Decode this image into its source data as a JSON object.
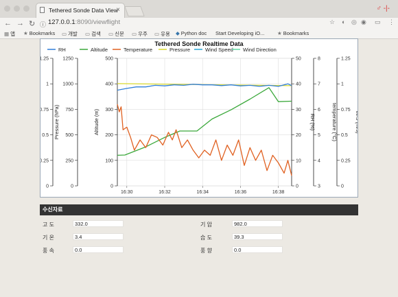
{
  "browser": {
    "tab_title": "Tethered Sonde Data View",
    "url_host": "127.0.0.1",
    "url_path": ":8090/viewflight",
    "ext_icon_text": "♂ -|-",
    "bookmarks": [
      {
        "icon": "apps-icon",
        "label": "앱"
      },
      {
        "icon": "star-icon",
        "label": "Bookmarks"
      },
      {
        "icon": "folder-icon",
        "label": "개발"
      },
      {
        "icon": "folder-icon",
        "label": "검색"
      },
      {
        "icon": "folder-icon",
        "label": "신문"
      },
      {
        "icon": "folder-icon",
        "label": "우주"
      },
      {
        "icon": "folder-icon",
        "label": "유용"
      },
      {
        "icon": "python-icon",
        "label": "Python doc"
      },
      {
        "icon": "apple-icon",
        "label": "Start Developing iO..."
      },
      {
        "icon": "star-icon",
        "label": "Bookmarks"
      }
    ]
  },
  "chart_data": {
    "type": "line",
    "title": "Tethered Sonde Realtime Data",
    "legend": [
      "RH",
      "Altitude",
      "Temperature",
      "Pressure",
      "Wind Speed",
      "Wind Direction"
    ],
    "legend_colors": [
      "#2f7ed8",
      "#3aa83a",
      "#e06020",
      "#d9d92a",
      "#29a7d6",
      "#5fd7a0"
    ],
    "legend_placement": "top",
    "x_ticks": [
      "16:30",
      "16:32",
      "16:34",
      "16:36",
      "16:38"
    ],
    "x_range_minutes": [
      29.5,
      38.7
    ],
    "grid": true,
    "axes": {
      "wd": {
        "label": "W/D (Degree)",
        "ticks": [
          "0",
          "0.25",
          "0.5",
          "0.75",
          "1",
          "1.25"
        ],
        "range": [
          0,
          1.25
        ]
      },
      "pressure": {
        "label": "Pressure (hPa)",
        "ticks": [
          "0",
          "250",
          "500",
          "750",
          "1000",
          "1250"
        ],
        "range": [
          0,
          1250
        ]
      },
      "altitude": {
        "label": "Altitude (m)",
        "ticks": [
          "0",
          "100",
          "200",
          "300",
          "400",
          "500"
        ],
        "range": [
          0,
          500
        ]
      },
      "rh": {
        "label": "RH (%)",
        "ticks": [
          "0",
          "10",
          "20",
          "30",
          "40",
          "50"
        ],
        "range": [
          0,
          50
        ]
      },
      "temperature": {
        "label": "temperature (°C)",
        "ticks": [
          "3",
          "4",
          "5",
          "6",
          "7",
          "8"
        ],
        "range": [
          3,
          8
        ]
      },
      "ws": {
        "label": "W/S (m/s)",
        "ticks": [
          "0",
          "0.25",
          "0.5",
          "0.75",
          "1",
          "1.25"
        ],
        "range": [
          0,
          1.25
        ]
      }
    },
    "series": [
      {
        "name": "Pressure",
        "axis": "pressure",
        "x": [
          29.5,
          38.7
        ],
        "values": [
          1002,
          982
        ]
      },
      {
        "name": "RH",
        "axis": "rh",
        "x": [
          29.5,
          30.0,
          30.5,
          31.0,
          31.5,
          32.0,
          32.5,
          33.0,
          33.5,
          34.0,
          34.5,
          35.0,
          35.5,
          36.0,
          36.5,
          37.0,
          37.5,
          38.0,
          38.5,
          38.7
        ],
        "values": [
          37.5,
          38.2,
          38.8,
          38.8,
          39.4,
          39.2,
          39.6,
          39.4,
          39.8,
          39.6,
          39.6,
          39.3,
          39.6,
          39.2,
          39.4,
          39.0,
          39.4,
          39.0,
          40.0,
          39.3
        ]
      },
      {
        "name": "Altitude",
        "axis": "altitude",
        "x": [
          29.5,
          29.9,
          31.0,
          32.0,
          32.8,
          33.7,
          34.5,
          35.5,
          36.5,
          37.5,
          38.0,
          38.7
        ],
        "values": [
          120,
          121,
          153,
          190,
          215,
          215,
          262,
          298,
          340,
          385,
          330,
          332
        ]
      },
      {
        "name": "Temperature",
        "axis": "temperature",
        "x": [
          29.5,
          29.6,
          29.7,
          29.8,
          30.0,
          30.2,
          30.4,
          30.7,
          31.0,
          31.3,
          31.6,
          31.9,
          32.2,
          32.4,
          32.6,
          32.9,
          33.2,
          33.5,
          33.8,
          34.1,
          34.4,
          34.7,
          35.0,
          35.3,
          35.6,
          35.9,
          36.2,
          36.5,
          36.8,
          37.1,
          37.4,
          37.7,
          38.0,
          38.3,
          38.5,
          38.7
        ],
        "values": [
          6.2,
          5.9,
          6.1,
          5.2,
          5.3,
          4.9,
          4.4,
          4.8,
          4.5,
          5.0,
          4.9,
          4.6,
          5.1,
          4.8,
          5.2,
          4.5,
          4.8,
          4.4,
          4.1,
          4.4,
          4.2,
          4.8,
          4.0,
          4.6,
          4.2,
          4.8,
          3.8,
          4.5,
          4.0,
          4.4,
          3.6,
          4.2,
          3.9,
          3.5,
          4.0,
          3.4
        ]
      }
    ]
  },
  "data_panel": {
    "title": "수신자료",
    "fields": [
      {
        "label": "고 도",
        "value": "332.0"
      },
      {
        "label": "기 압",
        "value": "982.0"
      },
      {
        "label": "기 온",
        "value": "3.4"
      },
      {
        "label": "습 도",
        "value": "39.3"
      },
      {
        "label": "풍 속",
        "value": "0.0"
      },
      {
        "label": "풍 향",
        "value": "0.0"
      }
    ]
  }
}
